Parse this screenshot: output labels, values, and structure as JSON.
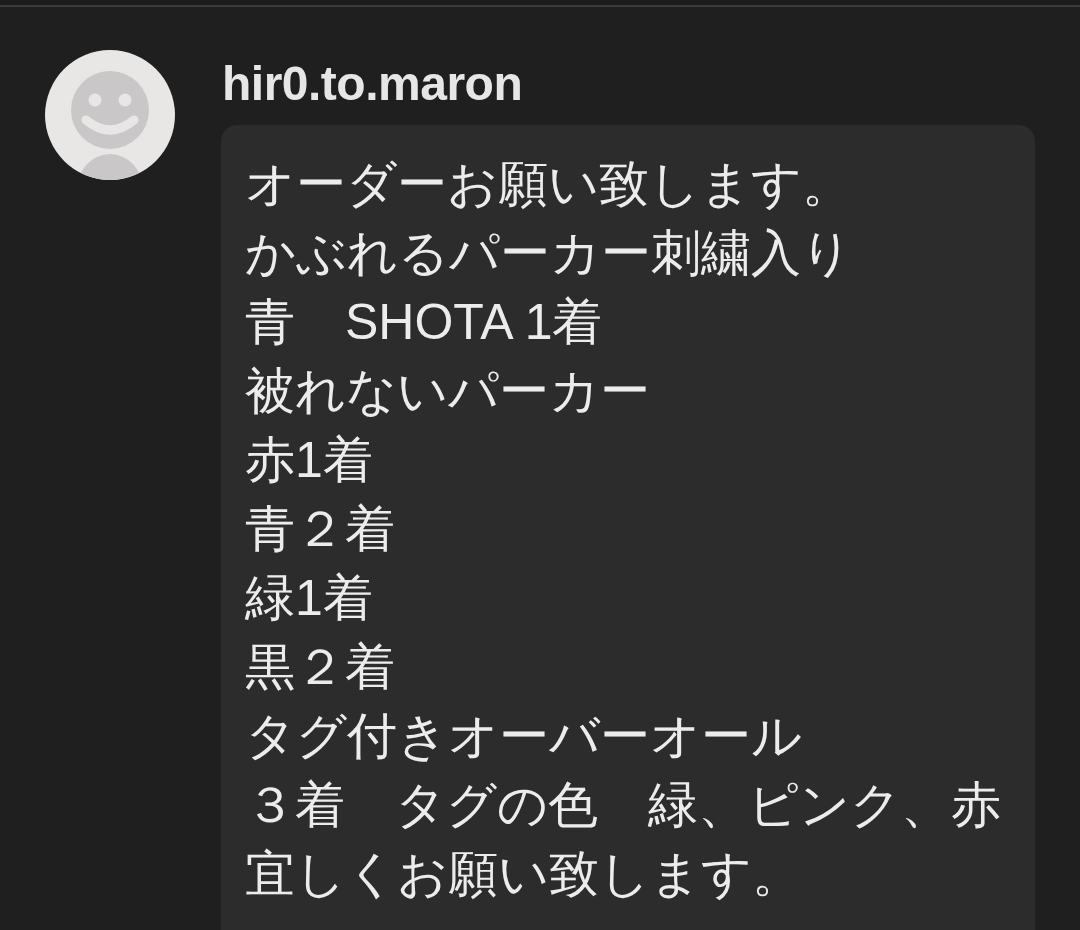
{
  "message": {
    "username": "hir0.to.maron",
    "lines": [
      "オーダーお願い致します。",
      "かぶれるパーカー刺繍入り",
      "青　SHOTA 1着",
      "被れないパーカー",
      "赤1着",
      "青２着",
      "緑1着",
      "黒２着",
      "タグ付きオーバーオール",
      "３着　タグの色　緑、ピンク、赤",
      "宜しくお願い致します。"
    ]
  }
}
